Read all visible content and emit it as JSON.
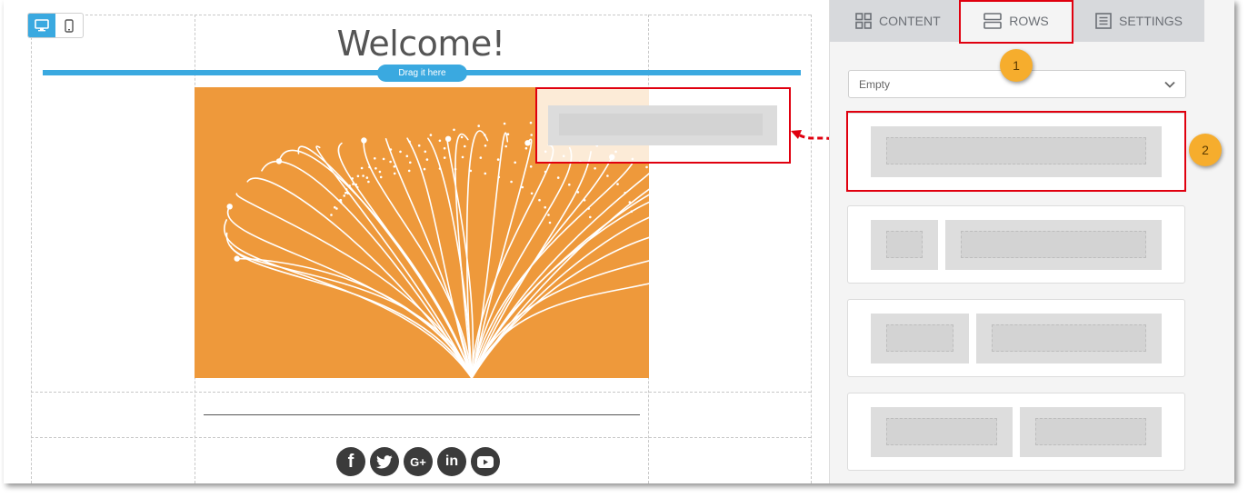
{
  "canvas": {
    "heading": "Welcome!",
    "drag_hint": "Drag it here",
    "device_modes": [
      "desktop-icon",
      "mobile-icon"
    ],
    "social_icons": [
      "facebook-icon",
      "twitter-icon",
      "google-plus-icon",
      "linkedin-icon",
      "youtube-icon"
    ],
    "social_labels": [
      "f",
      "G+",
      "in"
    ],
    "hero_background": "#ee993b"
  },
  "sidebar": {
    "tabs": [
      {
        "label": "CONTENT",
        "icon": "grid-icon"
      },
      {
        "label": "ROWS",
        "icon": "rows-icon",
        "active": true
      },
      {
        "label": "SETTINGS",
        "icon": "settings-list-icon"
      }
    ],
    "rows_filter": {
      "selected": "Empty"
    },
    "row_layouts": [
      {
        "name": "one-column",
        "columns": 1
      },
      {
        "name": "narrow-wide",
        "columns": 2
      },
      {
        "name": "third-twothirds",
        "columns": 2
      },
      {
        "name": "half-half",
        "columns": 2
      }
    ]
  },
  "callouts": [
    "1",
    "2"
  ],
  "colors": {
    "accent": "#3aa9e0",
    "highlight": "#e0000f",
    "callout": "#f6ad2d",
    "tabbar": "#d7d9dc"
  }
}
